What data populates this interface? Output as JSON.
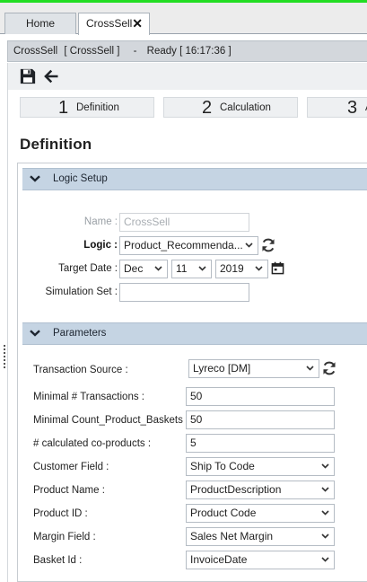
{
  "tabs": [
    {
      "label": "Home"
    },
    {
      "label": "CrossSell",
      "close_glyph": "✕"
    }
  ],
  "status": {
    "module": "CrossSell",
    "context": "[ CrossSell ]",
    "sep": "-",
    "state": "Ready [ 16:17:36 ]"
  },
  "toolbar": {
    "save_icon": "save-icon",
    "back_icon": "arrow-left-icon"
  },
  "steps": [
    {
      "num": "1",
      "label": "Definition"
    },
    {
      "num": "2",
      "label": "Calculation"
    },
    {
      "num": "3",
      "label": "A"
    }
  ],
  "page_title": "Definition",
  "logic_setup": {
    "header": "Logic Setup",
    "name_label": "Name :",
    "name_value": "CrossSell",
    "logic_label": "Logic :",
    "logic_value": "Product_Recommenda...",
    "target_date_label": "Target Date :",
    "month": "Dec",
    "day": "11",
    "year": "2019",
    "simulation_set_label": "Simulation Set :",
    "simulation_set_value": ""
  },
  "parameters": {
    "header": "Parameters",
    "transaction_source_label": "Transaction Source :",
    "transaction_source_value": "Lyreco [DM]",
    "min_transactions_label": "Minimal # Transactions :",
    "min_transactions_value": "50",
    "min_count_baskets_label": "Minimal Count_Product_Baskets :",
    "min_count_baskets_value": "50",
    "calc_coproducts_label": "# calculated co-products :",
    "calc_coproducts_value": "5",
    "customer_field_label": "Customer Field :",
    "customer_field_value": "Ship To Code",
    "product_name_label": "Product Name :",
    "product_name_value": "ProductDescription",
    "product_id_label": "Product ID :",
    "product_id_value": "Product Code",
    "margin_field_label": "Margin Field :",
    "margin_field_value": "Sales Net Margin",
    "basket_id_label": "Basket Id :",
    "basket_id_value": "InvoiceDate"
  },
  "colors": {
    "top_accent": "#22dd22",
    "section_header": "#c5d4e3"
  }
}
